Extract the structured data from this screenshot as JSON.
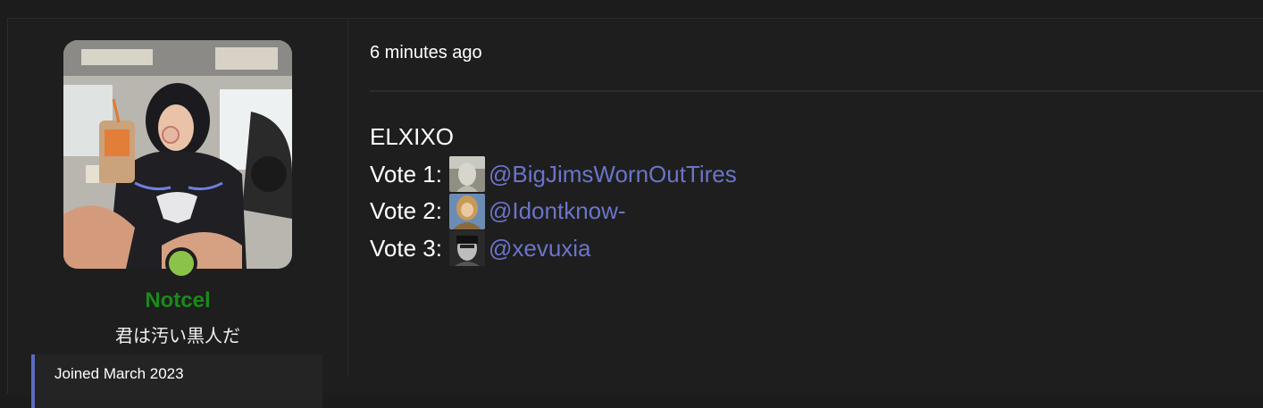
{
  "user": {
    "name": "Notcel",
    "title": "君は汚い黒人だ",
    "extra": "Joined     March 2023"
  },
  "post": {
    "time": "6 minutes ago",
    "heading": "ELXIXO",
    "votes": [
      {
        "label": "Vote 1:",
        "mention": "@BigJimsWornOutTires",
        "avatar": "mini-avatar-statue"
      },
      {
        "label": "Vote 2:",
        "mention": "@Idontknow-",
        "avatar": "mini-avatar-knight"
      },
      {
        "label": "Vote 3:",
        "mention": "@xevuxia",
        "avatar": "mini-avatar-bw-person"
      }
    ]
  },
  "colors": {
    "username": "#1a8a1a",
    "mention": "#6b74c9",
    "status": "#8bc34a"
  }
}
